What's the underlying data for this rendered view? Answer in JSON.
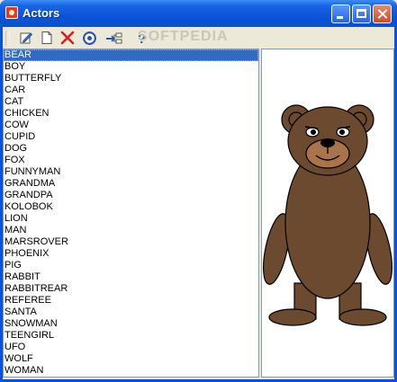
{
  "window": {
    "title": "Actors"
  },
  "toolbar": {
    "tools": [
      "edit-icon",
      "new-file-icon",
      "delete-icon",
      "settings-icon",
      "export-icon",
      "help-icon"
    ],
    "watermark": "SOFTPEDIA"
  },
  "actors": {
    "selected": "BEAR",
    "items": [
      "BEAR",
      "BOY",
      "BUTTERFLY",
      "CAR",
      "CAT",
      "CHICKEN",
      "COW",
      "CUPID",
      "DOG",
      "FOX",
      "FUNNYMAN",
      "GRANDMA",
      "GRANDPA",
      "KOLOBOK",
      "LION",
      "MAN",
      "MARSROVER",
      "PHOENIX",
      "PIG",
      "RABBIT",
      "RABBITREAR",
      "REFEREE",
      "SANTA",
      "SNOWMAN",
      "TEENGIRL",
      "UFO",
      "WOLF",
      "WOMAN"
    ]
  },
  "colors": {
    "bear_fur": "#6b4a2f",
    "bear_light": "#a9744a",
    "selection": "#316ac5"
  }
}
